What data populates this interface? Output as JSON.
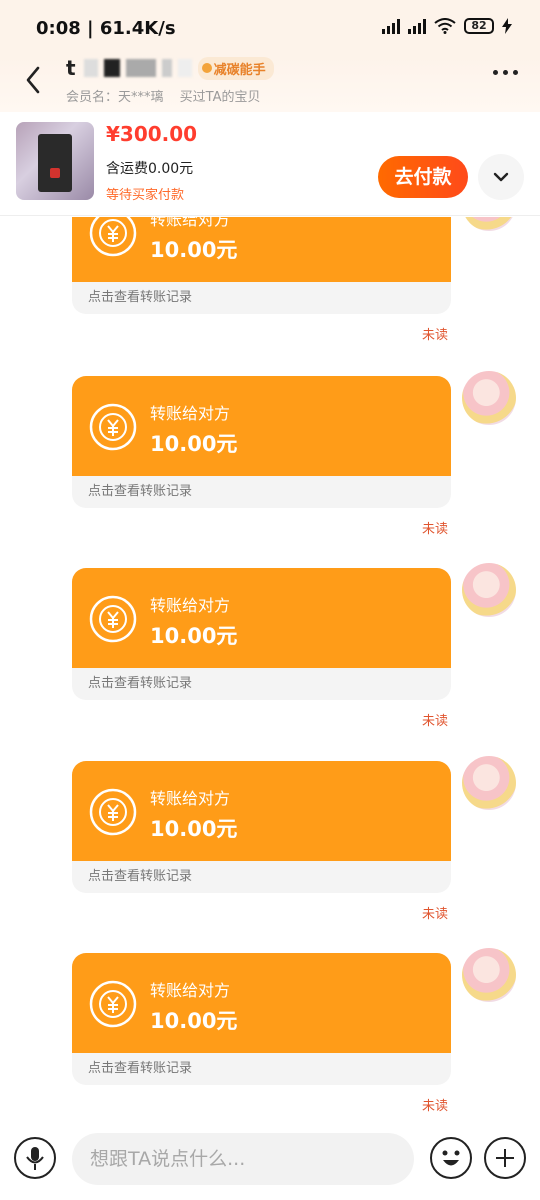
{
  "status_bar": {
    "time_speed": "0:08 | 61.4K/s",
    "battery": "82"
  },
  "header": {
    "title_initial": "t",
    "badge": "减碳能手",
    "member_label": "会员名：天***璃",
    "bought_label": "买过TA的宝贝",
    "icons": {
      "back": "back-arrow-icon",
      "more": "more-dots-icon"
    }
  },
  "order": {
    "price": "¥300.00",
    "shipping": "含运费0.00元",
    "status": "等待买家付款",
    "pay_button": "去付款",
    "expand_icon": "chevron-down-icon"
  },
  "messages": [
    {
      "title": "转账给对方",
      "amount": "10.00元",
      "footer": "点击查看转账记录",
      "status": "未读"
    },
    {
      "title": "转账给对方",
      "amount": "10.00元",
      "footer": "点击查看转账记录",
      "status": "未读"
    },
    {
      "title": "转账给对方",
      "amount": "10.00元",
      "footer": "点击查看转账记录",
      "status": "未读"
    },
    {
      "title": "转账给对方",
      "amount": "10.00元",
      "footer": "点击查看转账记录",
      "status": "未读"
    },
    {
      "title": "转账给对方",
      "amount": "10.00元",
      "footer": "点击查看转账记录",
      "status": "未读"
    }
  ],
  "input_bar": {
    "placeholder": "想跟TA说点什么...",
    "icons": {
      "voice": "microphone-icon",
      "emoji": "emoji-icon",
      "more": "plus-icon"
    }
  },
  "colors": {
    "transfer_bubble": "#ff9c18",
    "pay_button": "#ff4a1a",
    "price": "#ff3d2e",
    "unread": "#e0552f"
  }
}
